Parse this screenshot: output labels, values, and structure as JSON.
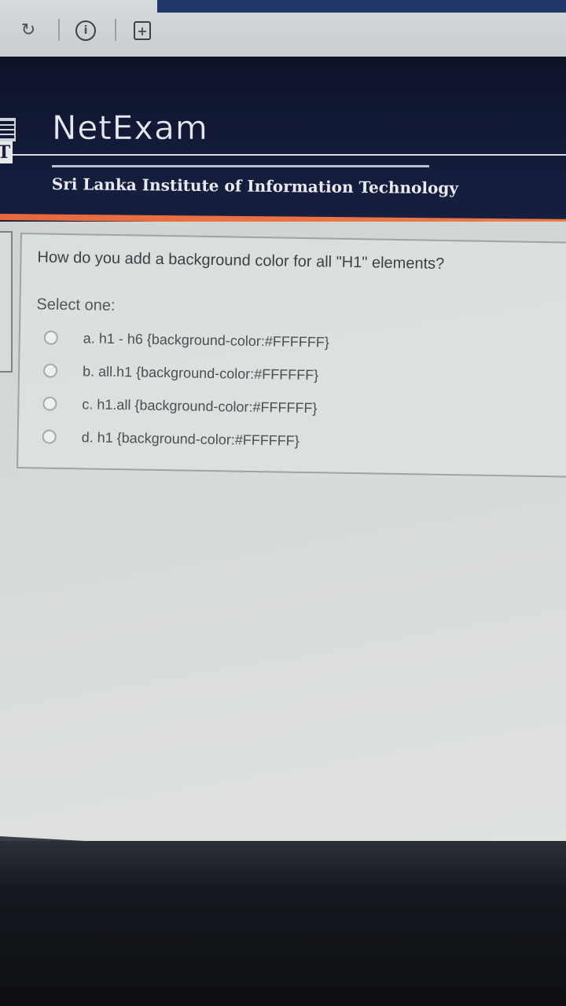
{
  "browser": {
    "reload_icon": "reload-icon",
    "info_icon": "info-icon",
    "info_glyph": "i",
    "new_tab_icon": "new-tab-icon",
    "new_tab_glyph": "+"
  },
  "header": {
    "title": "NetExam",
    "subtitle": "Sri Lanka Institute of Information Technology",
    "logo_letter": "T",
    "colors": {
      "banner": "#141c3a",
      "stripe": "#ec7345"
    }
  },
  "question": {
    "text": "How do you add a background color for all \"H1\" elements?",
    "prompt": "Select one:",
    "options": [
      {
        "label": "a. h1 - h6 {background-color:#FFFFFF}",
        "selected": false
      },
      {
        "label": "b. all.h1 {background-color:#FFFFFF}",
        "selected": false
      },
      {
        "label": "c. h1.all {background-color:#FFFFFF}",
        "selected": false
      },
      {
        "label": "d. h1 {background-color:#FFFFFF}",
        "selected": false
      }
    ]
  }
}
